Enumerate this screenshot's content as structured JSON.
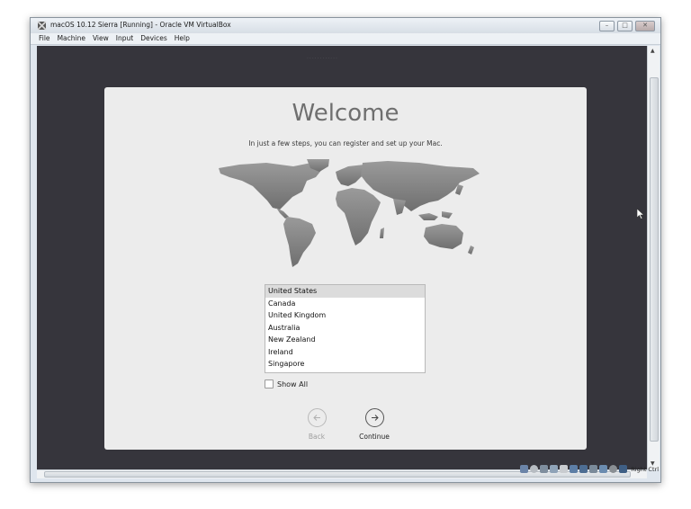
{
  "window": {
    "title": "macOS 10.12 Sierra [Running] - Oracle VM VirtualBox",
    "menus": [
      "File",
      "Machine",
      "View",
      "Input",
      "Devices",
      "Help"
    ]
  },
  "setup": {
    "heading": "Welcome",
    "subtitle": "In just a few steps, you can register and set up your Mac.",
    "countries": [
      "United States",
      "Canada",
      "United Kingdom",
      "Australia",
      "New Zealand",
      "Ireland",
      "Singapore"
    ],
    "selected_country": "United States",
    "show_all_label": "Show All",
    "back_label": "Back",
    "continue_label": "Continue"
  },
  "statusbar": {
    "host_key": "Right Ctrl"
  },
  "colors": {
    "vm_background": "#36353c",
    "dialog_background": "#ececec",
    "map_land": "#8e8e8e",
    "selection": "#dcdcdc"
  }
}
